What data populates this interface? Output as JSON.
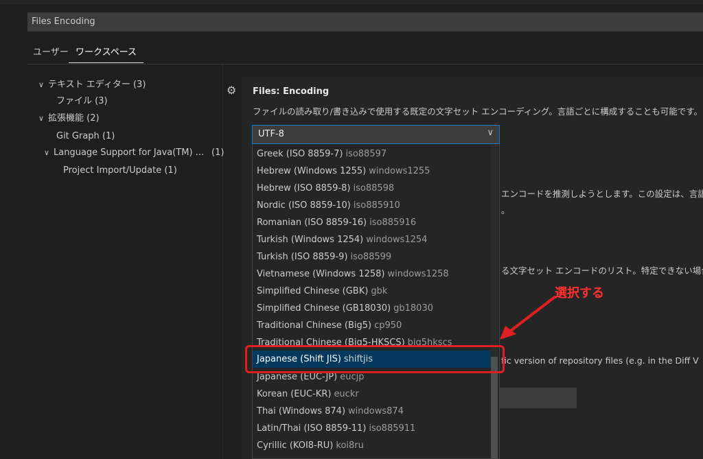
{
  "search": {
    "value": "Files Encoding"
  },
  "tabs": [
    {
      "label": "ユーザー"
    },
    {
      "label": "ワークスペース"
    }
  ],
  "toc": [
    {
      "label": "テキスト エディター",
      "count": "(3)",
      "expanded": true
    },
    {
      "label": "ファイル",
      "count": "(3)"
    },
    {
      "label": "拡張機能",
      "count": "(2)",
      "expanded": true
    },
    {
      "label": "Git Graph",
      "count": "(1)"
    },
    {
      "label": "Language Support for Java(TM) ...",
      "count": "(1)",
      "expanded": true
    },
    {
      "label": "Project Import/Update",
      "count": "(1)"
    }
  ],
  "setting": {
    "category": "Files: ",
    "name": "Encoding",
    "description": "ファイルの読み取り/書き込みで使用する既定の文字セット エンコーディング。言語ごとに構成することも可能です。",
    "value": "UTF-8"
  },
  "dropdown": {
    "options": [
      {
        "label": "Greek (ISO 8859-7)",
        "id": "iso88597"
      },
      {
        "label": "Hebrew (Windows 1255)",
        "id": "windows1255"
      },
      {
        "label": "Hebrew (ISO 8859-8)",
        "id": "iso88598"
      },
      {
        "label": "Nordic (ISO 8859-10)",
        "id": "iso885910"
      },
      {
        "label": "Romanian (ISO 8859-16)",
        "id": "iso885916"
      },
      {
        "label": "Turkish (Windows 1254)",
        "id": "windows1254"
      },
      {
        "label": "Turkish (ISO 8859-9)",
        "id": "iso88599"
      },
      {
        "label": "Vietnamese (Windows 1258)",
        "id": "windows1258"
      },
      {
        "label": "Simplified Chinese (GBK)",
        "id": "gbk"
      },
      {
        "label": "Simplified Chinese (GB18030)",
        "id": "gb18030"
      },
      {
        "label": "Traditional Chinese (Big5)",
        "id": "cp950"
      },
      {
        "label": "Traditional Chinese (Big5-HKSCS)",
        "id": "big5hkscs"
      },
      {
        "label": "Japanese (Shift JIS)",
        "id": "shiftjis",
        "selected": true
      },
      {
        "label": "Japanese (EUC-JP)",
        "id": "eucjp"
      },
      {
        "label": "Korean (EUC-KR)",
        "id": "euckr"
      },
      {
        "label": "Thai (Windows 874)",
        "id": "windows874"
      },
      {
        "label": "Latin/Thai (ISO 8859-11)",
        "id": "iso885911"
      },
      {
        "label": "Cyrillic (KOI8-RU)",
        "id": "koi8ru"
      }
    ]
  },
  "background": {
    "line1": "エンコードを推測しようとします。この設定は、言語ご",
    "line1b": "。",
    "line2": "る文字セット エンコードのリスト。特定できない場合は、",
    "line3": "fic version of repository files (e.g. in the Diff V"
  },
  "annotation": {
    "text": "選択する",
    "color": "#ff3030"
  },
  "colors": {
    "accent": "#007fd4",
    "selection": "#04395e",
    "highlight": "#e02020"
  },
  "icons": {
    "gear": "gear-icon",
    "chevron": "chevron-down-icon"
  }
}
